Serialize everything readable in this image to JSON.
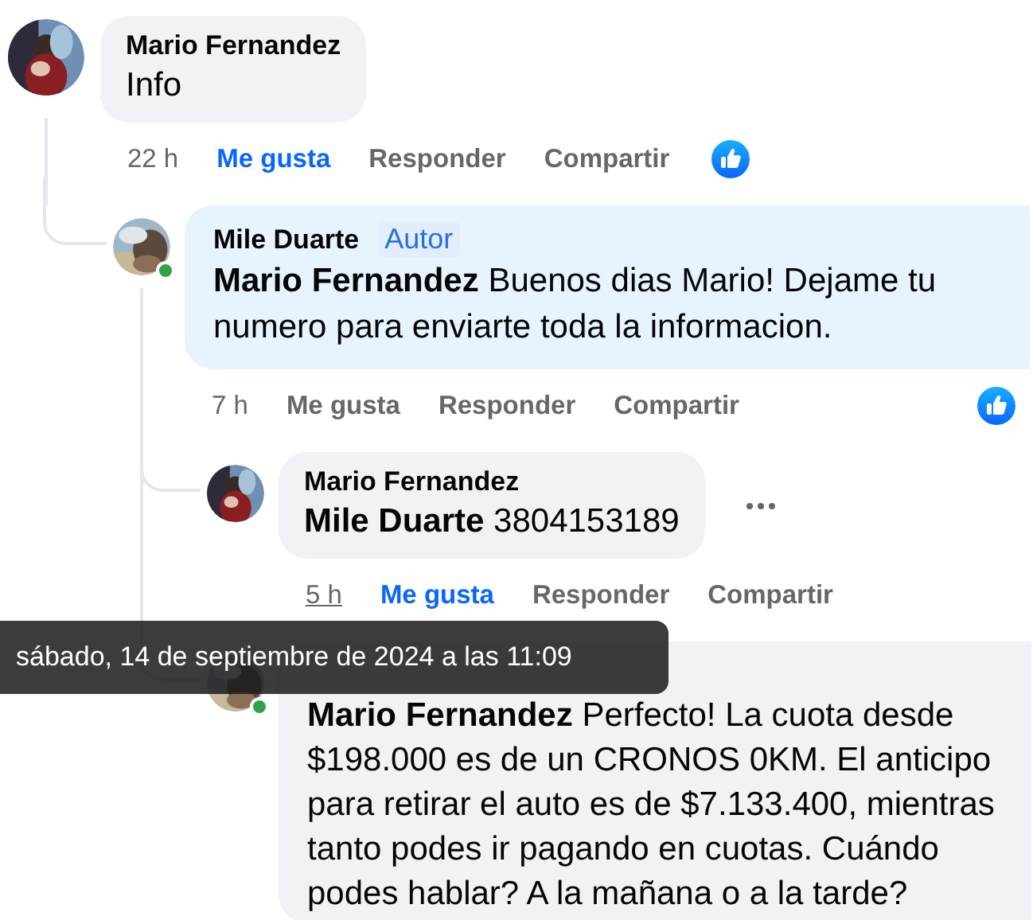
{
  "comments": [
    {
      "author": "Mario Fernandez",
      "text": "Info",
      "time": "22 h",
      "time_hovered": false,
      "like_selected": true,
      "like_label": "Me gusta",
      "reply_label": "Responder",
      "share_label": "Compartir",
      "reaction": true,
      "children": [
        {
          "author": "Mile Duarte",
          "badge": "Autor",
          "text": "**Mario Fernandez** Buenos dias Mario! Dejame tu numero para enviarte toda la informacion.",
          "time": "7 h",
          "time_hovered": false,
          "online": true,
          "like_selected": false,
          "like_label": "Me gusta",
          "reply_label": "Responder",
          "share_label": "Compartir",
          "reaction": true,
          "children": [
            {
              "author": "Mario Fernandez",
              "text": "**Mile Duarte** 3804153189",
              "time": "5 h",
              "time_hovered": true,
              "like_selected": true,
              "like_label": "Me gusta",
              "reply_label": "Responder",
              "share_label": "Compartir",
              "more_button": true
            },
            {
              "text": "**Mario Fernandez** Perfecto! La cuota desde $198.000 es de un CRONOS 0KM. El anticipo para retirar el auto es de $7.133.400, mientras tanto podes ir pagando en cuotas. Cuándo podes hablar? A la mañana o a la tarde?",
              "online": true
            }
          ]
        }
      ]
    }
  ],
  "tooltip": {
    "text": "sábado, 14 de septiembre de 2024 a las 11:09"
  }
}
